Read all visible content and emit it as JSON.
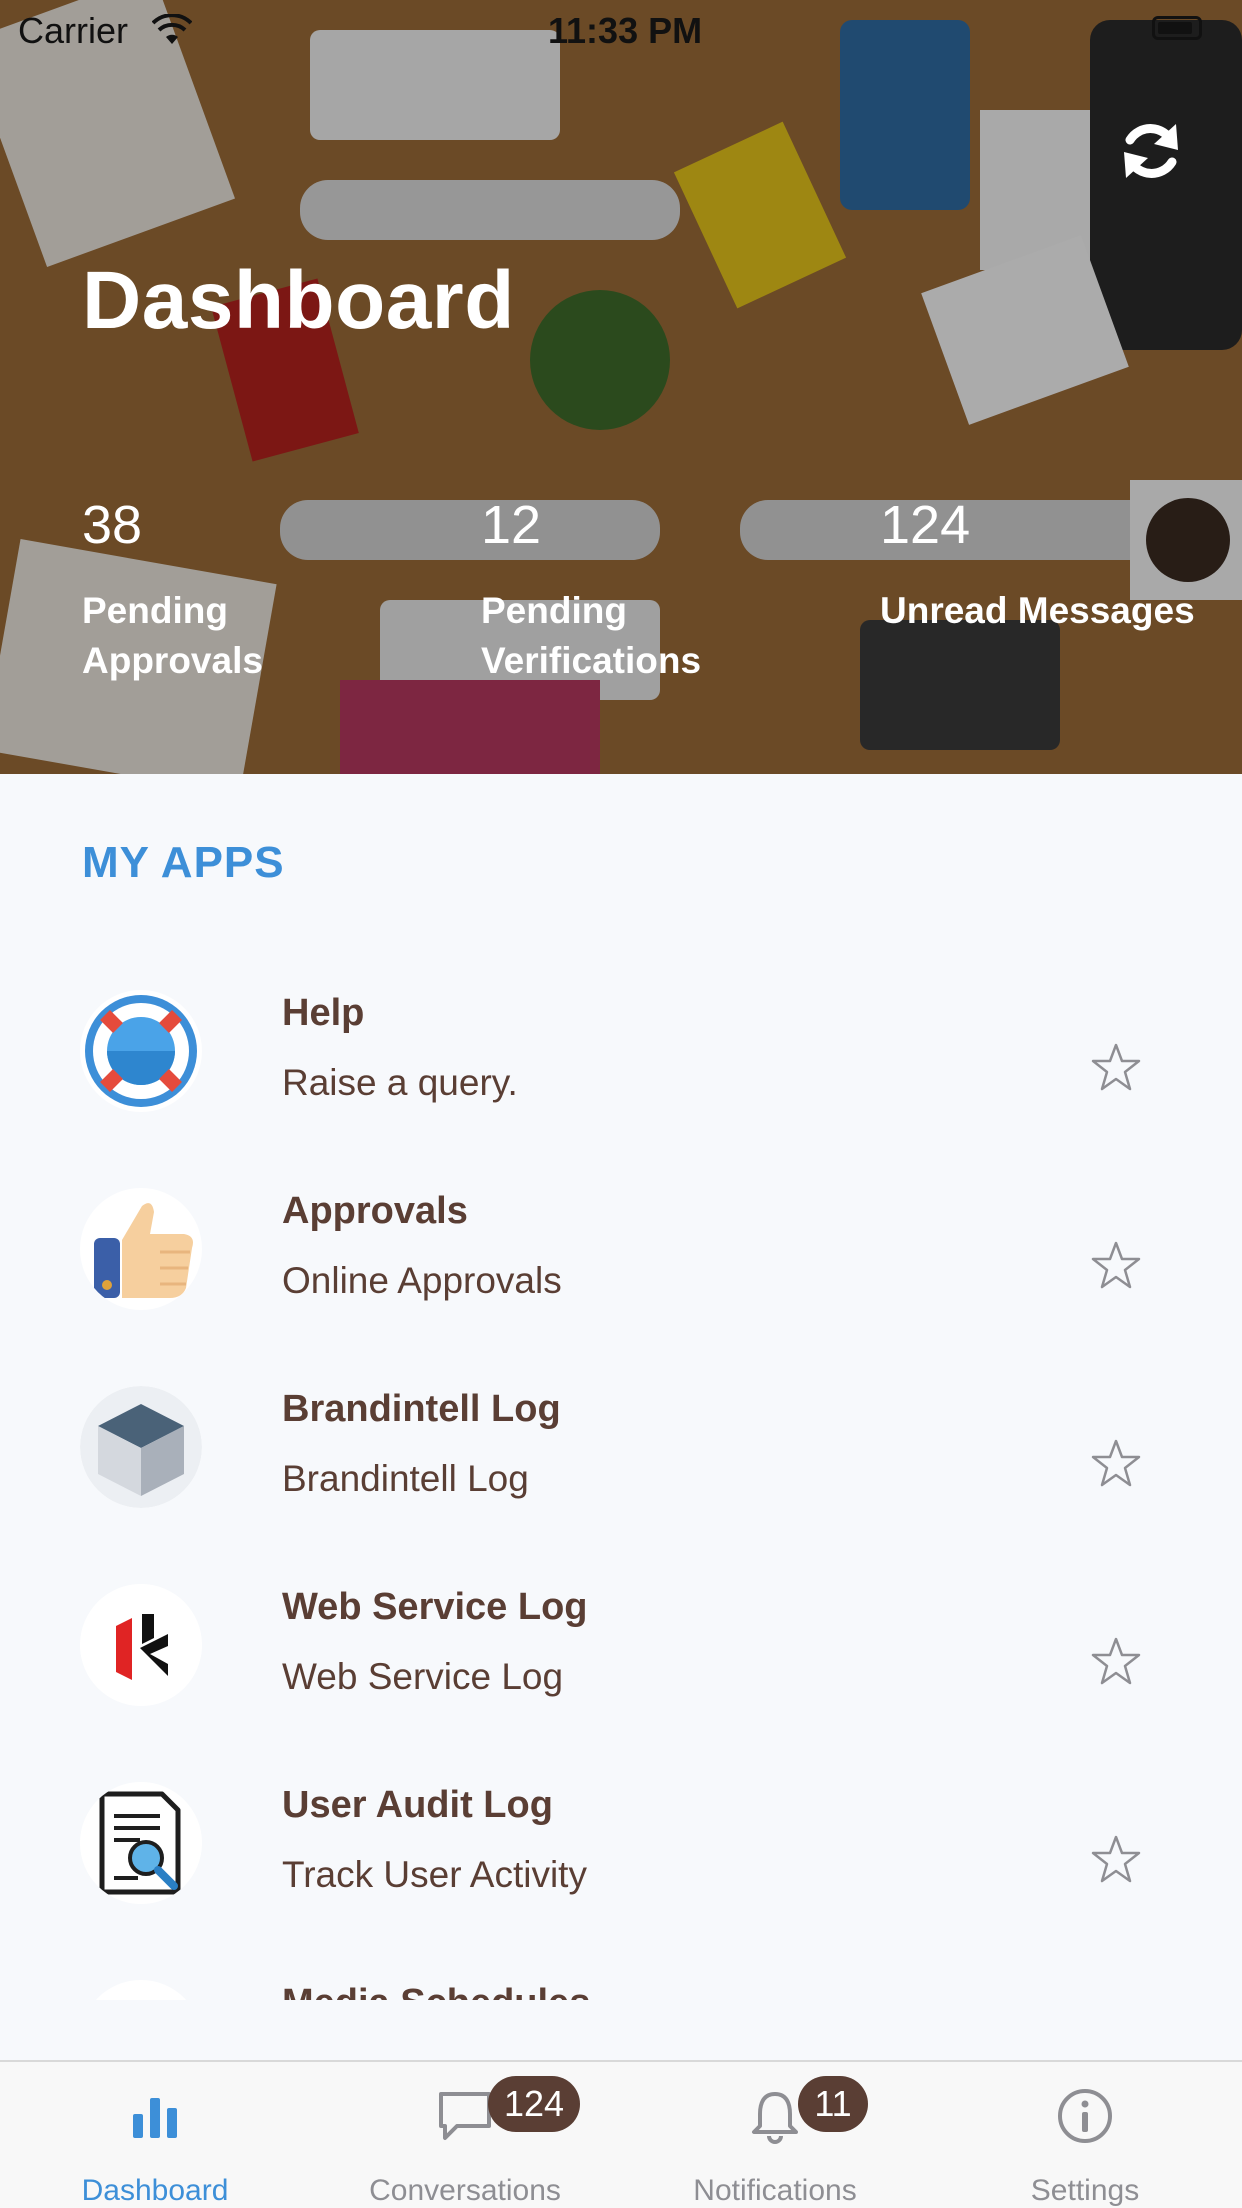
{
  "status_bar": {
    "carrier": "Carrier",
    "time": "11:33 PM"
  },
  "header": {
    "title": "Dashboard",
    "stats": [
      {
        "value": "38",
        "label": "Pending Approvals"
      },
      {
        "value": "12",
        "label": "Pending Verifications"
      },
      {
        "value": "124",
        "label": "Unread Messages"
      }
    ]
  },
  "apps": {
    "section_title": "MY APPS",
    "items": [
      {
        "title": "Help",
        "subtitle": "Raise a query.",
        "icon": "lifebuoy-icon"
      },
      {
        "title": "Approvals",
        "subtitle": "Online Approvals",
        "icon": "thumbs-up-icon"
      },
      {
        "title": "Brandintell Log",
        "subtitle": "Brandintell Log",
        "icon": "cube-icon"
      },
      {
        "title": "Web Service Log",
        "subtitle": "Web Service Log",
        "icon": "web-service-logo-icon"
      },
      {
        "title": "User Audit Log",
        "subtitle": "Track User Activity",
        "icon": "document-search-icon"
      },
      {
        "title": "Media Schedules",
        "subtitle": "",
        "icon": "calendar-icon"
      }
    ]
  },
  "tab_bar": {
    "tabs": [
      {
        "label": "Dashboard",
        "icon": "bar-chart-icon",
        "active": true
      },
      {
        "label": "Conversations",
        "icon": "chat-bubble-icon",
        "badge": "124"
      },
      {
        "label": "Notifications",
        "icon": "bell-icon",
        "badge": "11"
      },
      {
        "label": "Settings",
        "icon": "info-circle-icon"
      }
    ]
  },
  "colors": {
    "accent": "#3d8fd8",
    "text_brown": "#5a3e34",
    "background": "#f7f9fc"
  }
}
